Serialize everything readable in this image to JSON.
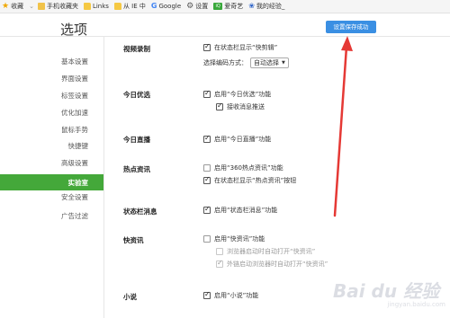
{
  "bookmarks": [
    {
      "icon": "star-icon",
      "label": "收藏"
    },
    {
      "icon": "phone-icon",
      "label": "手机收藏夹"
    },
    {
      "icon": "folder-icon",
      "label": "Links"
    },
    {
      "icon": "folder-icon",
      "label": "从 IE 中"
    },
    {
      "icon": "google-icon",
      "label": "Google"
    },
    {
      "icon": "gear-icon",
      "label": "设置"
    },
    {
      "icon": "app-icon",
      "label": "爱奇艺"
    },
    {
      "icon": "paw-icon",
      "label": "我的经验_"
    }
  ],
  "header": {
    "title": "选项",
    "toast": "设置保存成功"
  },
  "sidebar": {
    "items": [
      {
        "label": "基本设置"
      },
      {
        "label": "界面设置"
      },
      {
        "label": "标签设置"
      },
      {
        "label": "优化加速"
      },
      {
        "label": "鼠标手势"
      },
      {
        "label": "快捷键"
      },
      {
        "label": "高级设置"
      },
      {
        "label": "实验室",
        "active": true
      },
      {
        "label": "安全设置"
      },
      {
        "label": "广告过滤"
      }
    ]
  },
  "sections": {
    "video": {
      "title": "视频录制",
      "opt1": "在状态栏显示“快剪辑”",
      "encode_label": "选择编码方式：",
      "encode_value": "自动选择"
    },
    "today_pick": {
      "title": "今日优选",
      "opt1": "启用“今日优选”功能",
      "opt2": "接收消息推送"
    },
    "today_live": {
      "title": "今日直播",
      "opt1": "启用“今日直播”功能"
    },
    "hot_news": {
      "title": "热点资讯",
      "opt1": "启用“360热点资讯”功能",
      "opt2": "在状态栏显示“热点资讯”按钮"
    },
    "statusbar_msg": {
      "title": "状态栏消息",
      "opt1": "启用“状态栏消息”功能"
    },
    "quick_news": {
      "title": "快资讯",
      "opt1": "启用“快资讯”功能",
      "opt2": "浏览器启动时自动打开“快资讯”",
      "opt3": "外链启动浏览器时自动打开“快资讯”"
    },
    "novel": {
      "title": "小说",
      "opt1": "启用“小说”功能"
    }
  },
  "watermark": {
    "text": "Bai du 经验",
    "sub": "jingyan.baidu.com"
  },
  "colors": {
    "accent_green": "#44a83a",
    "toast_blue": "#3a8fe3",
    "annotation_red": "#e53935"
  }
}
